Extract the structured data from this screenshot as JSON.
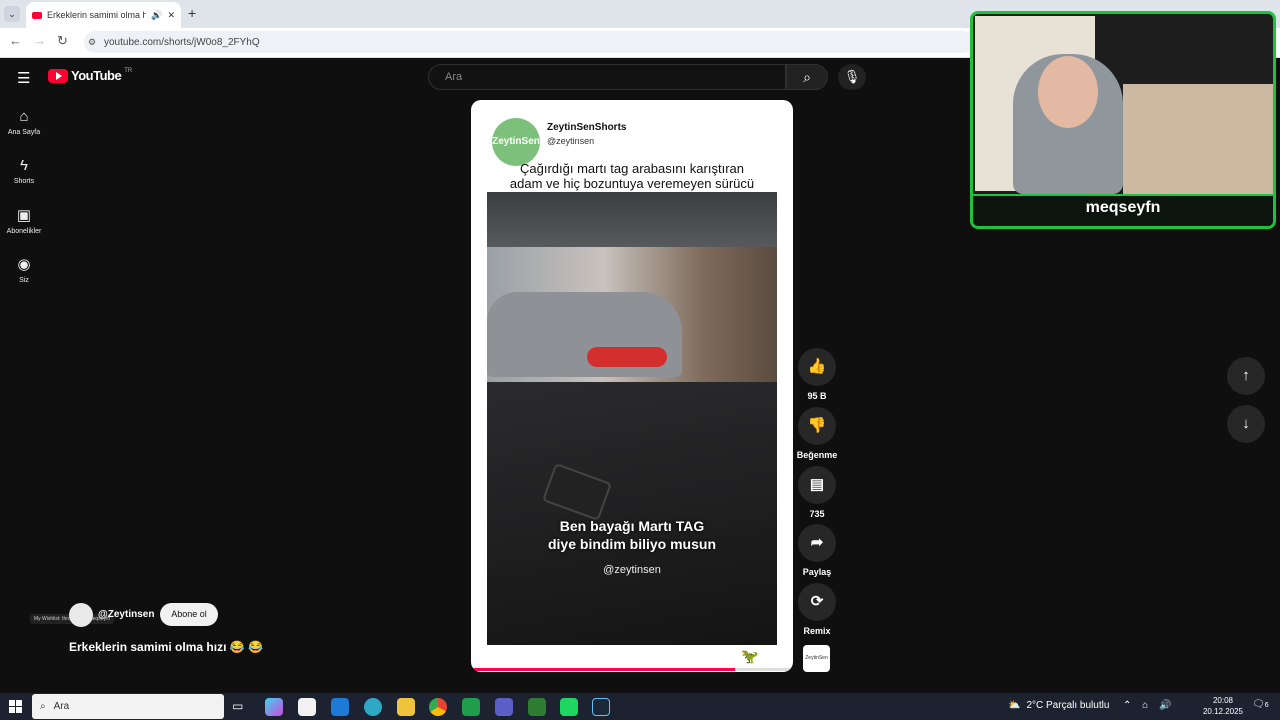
{
  "browser": {
    "tab_title": "Erkeklerin samimi olma hızı",
    "url": "youtube.com/shorts/jW0o8_2FYhQ"
  },
  "youtube": {
    "logo": "YouTube",
    "region": "TR",
    "search_placeholder": "Ara",
    "sidebar": [
      {
        "label": "Ana Sayfa",
        "icon": "home-icon"
      },
      {
        "label": "Shorts",
        "icon": "shorts-icon"
      },
      {
        "label": "Abonelikler",
        "icon": "subscriptions-icon"
      },
      {
        "label": "Siz",
        "icon": "you-icon"
      }
    ]
  },
  "short": {
    "channel_name": "ZeytinSenShorts",
    "channel_handle": "@zeytinsen",
    "avatar_text": "ZeytinSen",
    "caption_line1": "Çağırdığı martı tag arabasını karıştıran",
    "caption_line2": "adam ve hiç bozuntuya veremeyen sürücü",
    "subtitle_line1": "Ben bayağı Martı TAG",
    "subtitle_line2": "diye bindim biliyo musun",
    "watermark": "@zeytinsen",
    "progress": 0.82
  },
  "actions": {
    "likes": "95 B",
    "dislike": "Beğenme",
    "comments": "735",
    "share": "Paylaş",
    "remix": "Remix",
    "sound_avatar": "ZeytinSen"
  },
  "channel_row": {
    "handle": "@Zeytinsen",
    "subscribe": "Abone ol",
    "title": "Erkeklerin samimi olma hızı 😂 😂",
    "overlay_text": "My Wishlist: throne.com/meqseyfn"
  },
  "webcam": {
    "streamer_name": "meqseyfn"
  },
  "taskbar": {
    "search": "Ara",
    "weather": "2°C  Parçalı bulutlu",
    "time": "20:08",
    "date": "20.12.2025",
    "notif": "6"
  },
  "colors": {
    "accent": "#ff0033",
    "cam_border": "#1ec23b",
    "progress": "#ff0050"
  }
}
